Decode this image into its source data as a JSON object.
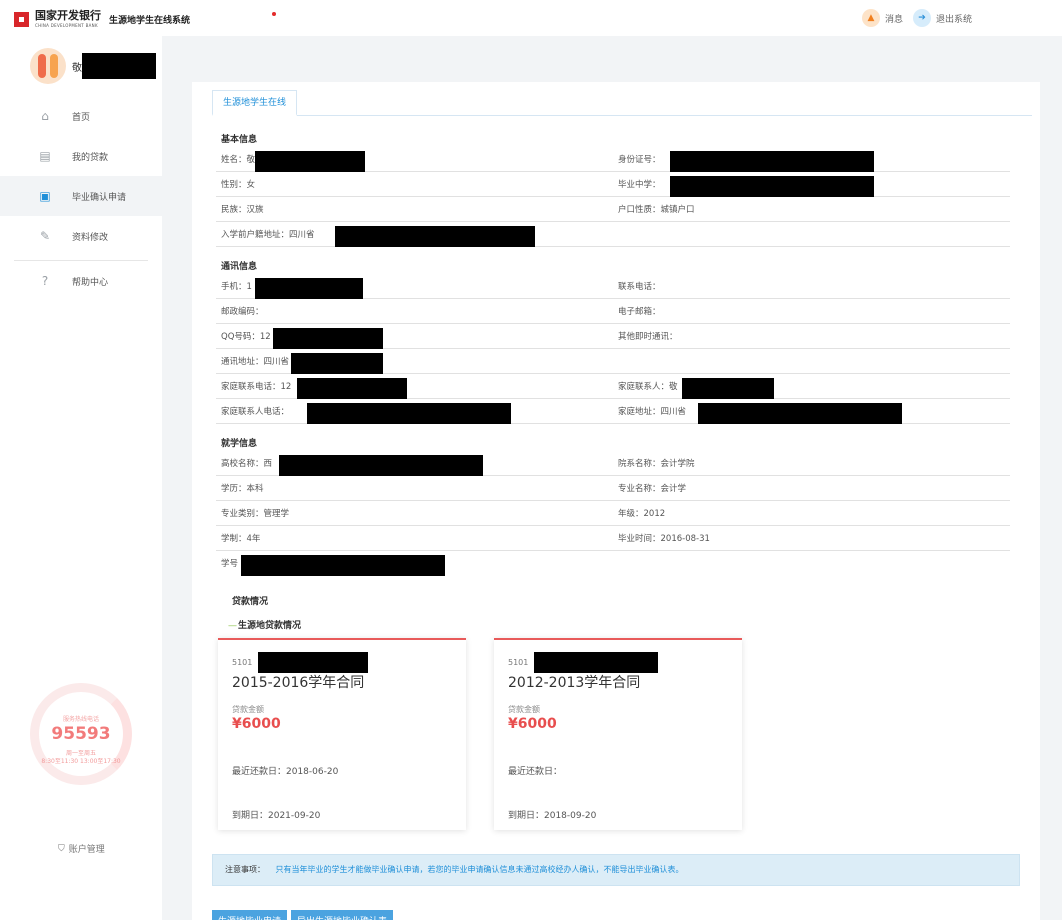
{
  "header": {
    "brand_name": "国家开发银行",
    "brand_en": "CHINA DEVELOPMENT BANK",
    "system_name": "生源地学生在线系统",
    "messages_label": "消息",
    "logout_label": "退出系统"
  },
  "sidebar": {
    "user_name": "敬",
    "items": [
      {
        "label": "首页",
        "icon": "home-icon"
      },
      {
        "label": "我的贷款",
        "icon": "document-icon"
      },
      {
        "label": "毕业确认申请",
        "icon": "inbox-icon"
      },
      {
        "label": "资料修改",
        "icon": "edit-icon"
      },
      {
        "label": "帮助中心",
        "icon": "help-icon"
      }
    ],
    "active_item": "毕业确认申请",
    "hotline_label": "服务热线电话",
    "hotline_number": "95593",
    "hotline_hours_1": "周一至周五",
    "hotline_hours_2": "8:30至11:30 13:00至17:30",
    "account_label": "账户管理"
  },
  "tab": {
    "label": "生源地学生在线"
  },
  "basic": {
    "title": "基本信息",
    "name": "姓名：敬",
    "id_number": "身份证号：",
    "gender": "性别：女",
    "high_school": "毕业中学：",
    "ethnicity": "民族：汉族",
    "hukou_type": "户口性质：城镇户口",
    "hukou_address": "入学前户籍地址：四川省"
  },
  "contact": {
    "title": "通讯信息",
    "mobile": "手机：1",
    "phone": "联系电话：",
    "postcode": "邮政编码：",
    "email": "电子邮箱：",
    "qq": "QQ号码：12",
    "im": "其他即时通讯：",
    "address": "通讯地址：四川省",
    "family_phone": "家庭联系电话：12",
    "family_contact": "家庭联系人：敬",
    "family_contact_phone": "家庭联系人电话：",
    "family_address": "家庭地址：四川省"
  },
  "study": {
    "title": "就学信息",
    "school": "高校名称：西",
    "department": "院系名称：会计学院",
    "degree": "学历：本科",
    "major": "专业名称：会计学",
    "major_category": "专业类别：管理学",
    "grade": "年级：2012",
    "duration": "学制：4年",
    "graduation": "毕业时间：2016-08-31",
    "student_id": "学号"
  },
  "loans": {
    "title": "贷款情况",
    "subtitle": "生源地贷款情况",
    "cards": [
      {
        "code": "5101",
        "name": "2015-2016学年合同",
        "amount_label": "贷款金额",
        "amount": "¥6000",
        "recent": "最近还款日：2018-06-20",
        "due": "到期日：2021-09-20"
      },
      {
        "code": "5101",
        "name": "2012-2013学年合同",
        "amount_label": "贷款金额",
        "amount": "¥6000",
        "recent": "最近还款日：",
        "due": "到期日：2018-09-20"
      }
    ]
  },
  "notice": {
    "label": "注意事项：",
    "text": "只有当年毕业的学生才能做毕业确认申请，若您的毕业申请确认信息未通过高校经办人确认，不能导出毕业确认表。"
  },
  "buttons": {
    "apply": "生源地毕业申请",
    "export": "导出生源地毕业确认表"
  },
  "colors": {
    "accent": "#1f8fd8",
    "brand_red": "#d8262a",
    "amount_red": "#e84e4e",
    "notice_bg": "#dcedf7"
  }
}
